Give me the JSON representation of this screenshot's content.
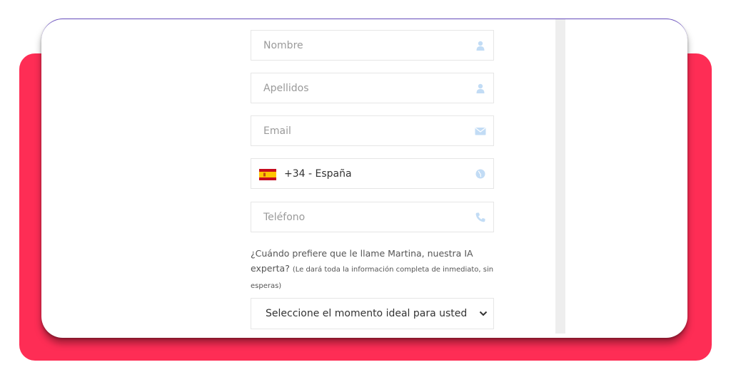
{
  "form": {
    "nombre_placeholder": "Nombre",
    "apellidos_placeholder": "Apellidos",
    "email_placeholder": "Email",
    "country_value": "+34 - España",
    "telefono_placeholder": "Teléfono",
    "question_main": "¿Cuándo prefiere que le llame Martina, nuestra IA experta?",
    "question_note": "(Le dará toda la información completa de inmediato, sin esperas)",
    "select_value": "Seleccione el momento ideal para usted"
  },
  "colors": {
    "accent_red": "#fe2d55",
    "icon_blue": "#c2dcf5"
  },
  "icons": [
    "user-icon",
    "user-icon",
    "envelope-icon",
    "spain-flag-icon",
    "globe-icon",
    "phone-icon",
    "chevron-down-icon"
  ]
}
